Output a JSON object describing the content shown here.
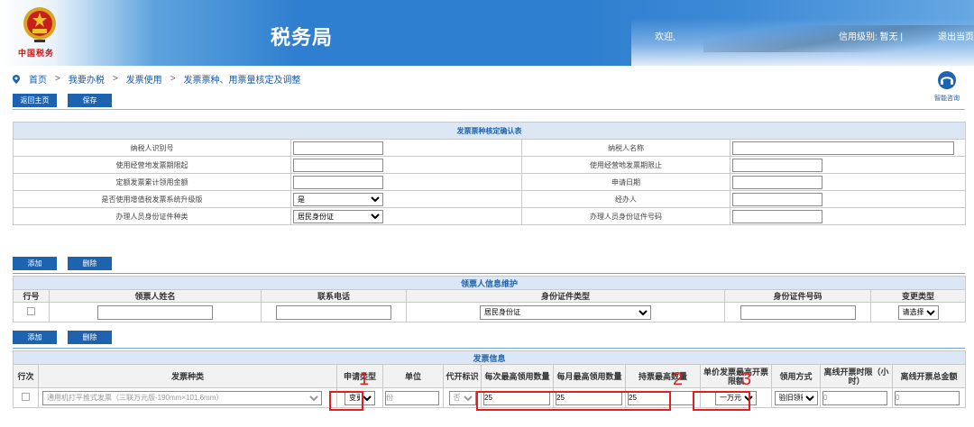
{
  "header": {
    "logo_text": "中国税务",
    "site_title": "税务局",
    "welcome": "欢迎,",
    "credit": "信用级别: 暂无 |",
    "logout": "退出当页"
  },
  "breadcrumb": [
    "首页",
    "我要办税",
    "发票使用",
    "发票票种、用票量核定及调整"
  ],
  "assist_label": "智能咨询",
  "top_buttons": {
    "back": "返回主页",
    "save": "保存"
  },
  "confirm_table": {
    "title": "发票票种核定确认表",
    "taxpayer_id_label": "纳税人识别号",
    "taxpayer_name_label": "纳税人名称",
    "period_start_label": "使用经营地发票期限起",
    "period_end_label": "使用经营地发票期限止",
    "quota_amount_label": "定额发票累计领用金额",
    "apply_date_label": "申请日期",
    "upgrade_label": "是否使用增值税发票系统升级版",
    "upgrade_value": "是",
    "handler_label": "经办人",
    "id_type_label": "办理人员身份证件种类",
    "id_type_value": "居民身份证",
    "id_no_label": "办理人员身份证件号码"
  },
  "holder_section": {
    "add": "添加",
    "delete": "删除",
    "title": "领票人信息维护",
    "columns": [
      "行号",
      "领票人姓名",
      "联系电话",
      "身份证件类型",
      "身份证件号码",
      "变更类型"
    ],
    "row": {
      "id_type": "居民身份证",
      "change_type": "请选择"
    }
  },
  "invoice_section": {
    "add": "添加",
    "delete": "删除",
    "title": "发票信息",
    "columns": [
      "行次",
      "发票种类",
      "申请类型",
      "单位",
      "代开标识",
      "每次最高领用数量",
      "每月最高领用数量",
      "持票最高数量",
      "单价发票最高开票限额",
      "领用方式",
      "离线开票时限（小时）",
      "离线开票总金额"
    ],
    "row": {
      "type": "通用机打平推式发票（三联万元版-190mm×101.6mm）",
      "apply_type": "变更",
      "unit": "份",
      "proxy_flag": "否",
      "per_time": "25",
      "per_month": "25",
      "max_hold": "25",
      "unit_limit": "一万元",
      "method": "验旧领新",
      "offline_hours": "0",
      "offline_amount": "0"
    }
  },
  "annotations": [
    "1",
    "2",
    "3"
  ]
}
